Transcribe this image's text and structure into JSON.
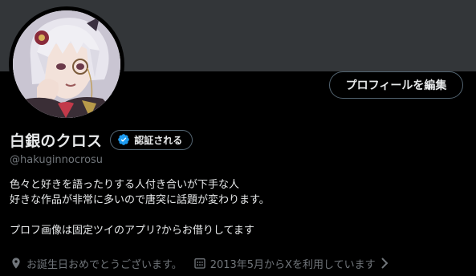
{
  "profile": {
    "display_name": "白銀のクロス",
    "verify_label": "認証される",
    "handle": "@hakuginnocrosu",
    "bio_lines": [
      "色々と好きを語ったりする人付き合いが下手な人",
      "好きな作品が非常に多いので唐突に話題が変わります。",
      "",
      "プロフ画像は固定ツイのアプリ?からお借りしてます"
    ],
    "birthday_text": "お誕生日おめでとうございます。",
    "joined_text": "2013年5月からXを利用しています"
  },
  "actions": {
    "edit_profile_label": "プロフィールを編集"
  },
  "icons": {
    "verify": "blue-check-icon",
    "birthday": "location-pin-icon",
    "joined": "calendar-icon",
    "more": "chevron-right-icon"
  },
  "colors": {
    "banner": "#333639",
    "background": "#000000",
    "primary_text": "#e7e9ea",
    "secondary_text": "#71767b",
    "border": "#536471",
    "verified_blue": "#1d9bf0"
  }
}
